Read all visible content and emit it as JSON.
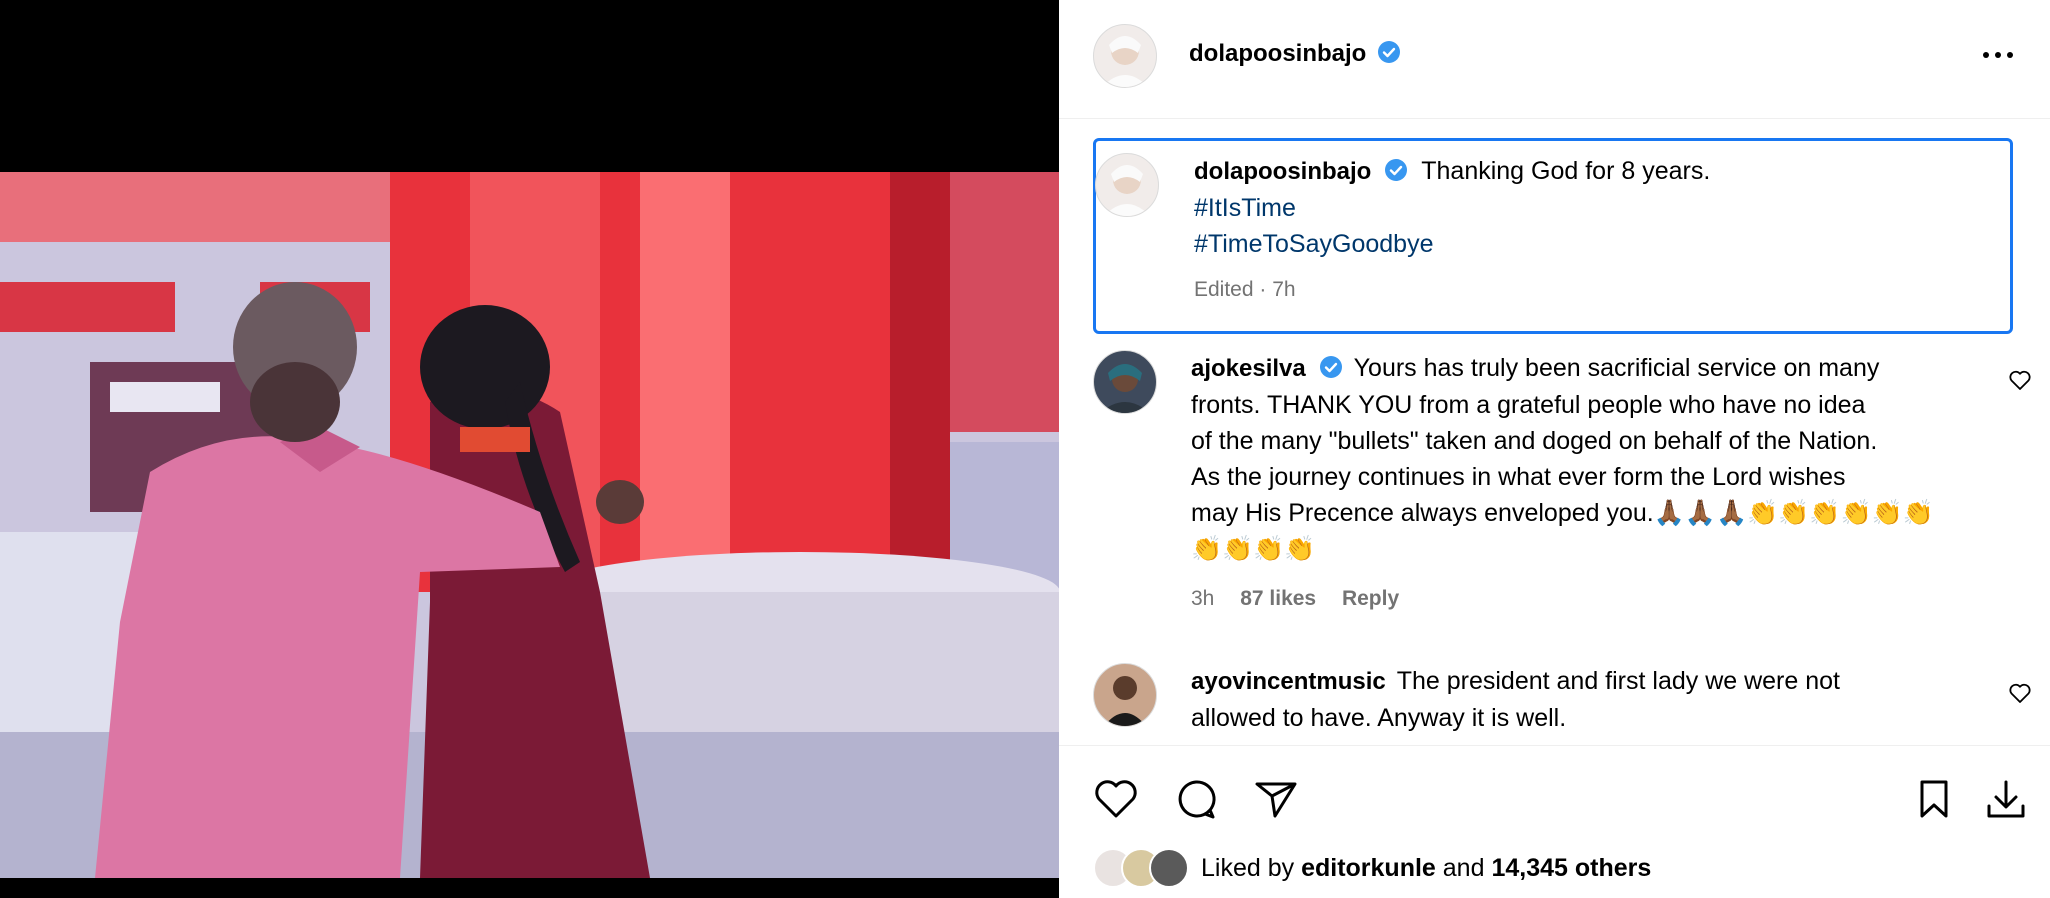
{
  "post": {
    "author": "dolapoosinbajo",
    "caption_text": "Thanking God for 8 years.",
    "hashtags": [
      "#ItIsTime",
      "#TimeToSayGoodbye"
    ],
    "caption_meta": "Edited · 7h",
    "liked_by_prefix": "Liked by",
    "liked_by_user": "editorkunle",
    "liked_by_middle": "and",
    "liked_by_count": "14,345 others"
  },
  "comments": [
    {
      "user": "ajokesilva",
      "verified": true,
      "text_line1": "Yours has truly been sacrificial service on many",
      "text_line2": "fronts. THANK YOU from a grateful people who have no idea",
      "text_line3": "of the many \"bullets\" taken and doged on behalf of the Nation.",
      "text_line4": "As the journey continues in what ever form the Lord wishes",
      "text_line5": "may His Precence always enveloped you.🙏🏾🙏🏾🙏🏾👏👏👏👏👏👏",
      "text_line6": "👏👏👏👏",
      "time": "3h",
      "likes": "87 likes",
      "reply_label": "Reply"
    },
    {
      "user": "ayovincentmusic",
      "verified": false,
      "text_line1": "The president and first lady we were not",
      "text_line2": "allowed to have. Anyway it is well."
    }
  ],
  "icons": {
    "more": "more-horizontal-icon",
    "verified": "verified-badge-icon",
    "like": "heart-icon",
    "comment": "comment-bubble-icon",
    "share": "paper-plane-icon",
    "save": "bookmark-icon",
    "download": "download-icon"
  },
  "colors": {
    "verified_blue": "#3897f0",
    "hashtag": "#00376b",
    "meta_gray": "#737373",
    "focus_border": "#1877f2"
  }
}
